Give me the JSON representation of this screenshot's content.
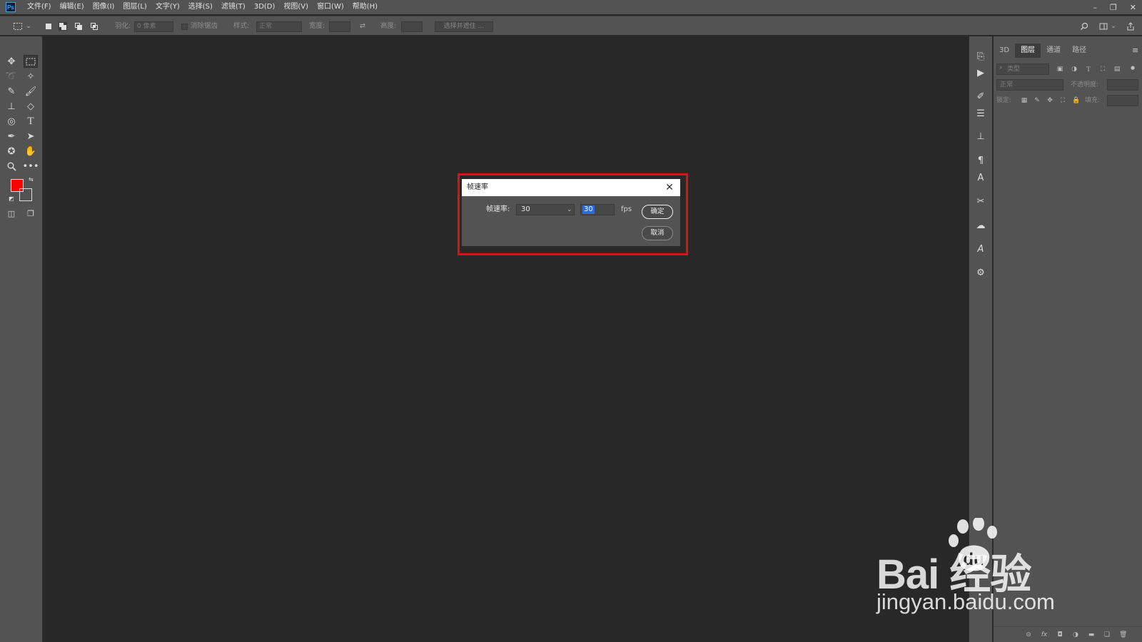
{
  "app": {
    "logo_text": "Ps"
  },
  "menu": {
    "items": [
      "文件(F)",
      "编辑(E)",
      "图像(I)",
      "图层(L)",
      "文字(Y)",
      "选择(S)",
      "滤镜(T)",
      "3D(D)",
      "视图(V)",
      "窗口(W)",
      "帮助(H)"
    ]
  },
  "window_controls": {
    "minimize": "–",
    "restore": "❐",
    "close": "✕"
  },
  "options_bar": {
    "feather_label": "羽化:",
    "feather_value": "0 像素",
    "antialias_label": "消除锯齿",
    "style_label": "样式:",
    "style_value": "正常",
    "width_label": "宽度:",
    "height_label": "高度:",
    "select_mask_label": "选择并遮住 ..."
  },
  "panel": {
    "tabs": [
      "3D",
      "图层",
      "通道",
      "路径"
    ],
    "active_tab": "图层",
    "filter_placeholder": "类型",
    "blend_mode": "正常",
    "opacity_label": "不透明度:",
    "lock_label": "锁定:",
    "fill_label": "填充:"
  },
  "dialog": {
    "title": "帧速率",
    "frame_rate_label": "帧速率:",
    "frame_rate_select": "30",
    "frame_rate_input": "30",
    "unit": "fps",
    "ok_label": "确定",
    "cancel_label": "取消"
  },
  "colors": {
    "foreground": "#ff0000",
    "background": "#535353",
    "highlight_border": "#e01010",
    "selection": "#2d6ad6"
  },
  "watermark": {
    "brand": "Bai  经验",
    "brand_du": "du",
    "url": "jingyan.baidu.com"
  }
}
